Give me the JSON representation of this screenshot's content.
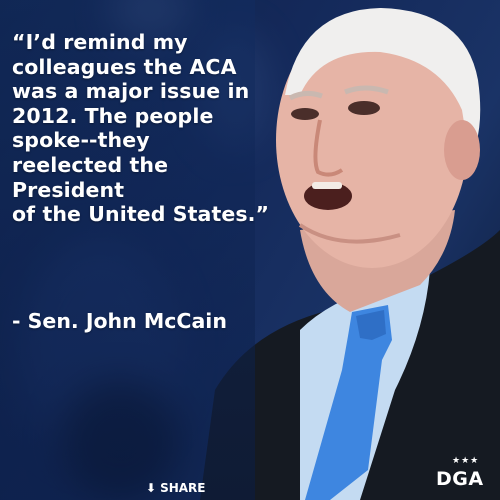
{
  "quote": {
    "lines": [
      "“I’d remind my",
      "colleagues the ACA",
      "was a major issue in",
      "2012. The people",
      "spoke--they",
      "reelected the",
      "President",
      "of the United States.”"
    ]
  },
  "attribution": "- Sen. John McCain",
  "share": {
    "label": "SHARE",
    "icon": "down-arrow-icon"
  },
  "logo": {
    "stars": "★★★",
    "text": "DGA"
  },
  "photo": {
    "subject": "speaking-man-portrait",
    "tie_color": "#3e86e0",
    "suit_color": "#151a22"
  }
}
